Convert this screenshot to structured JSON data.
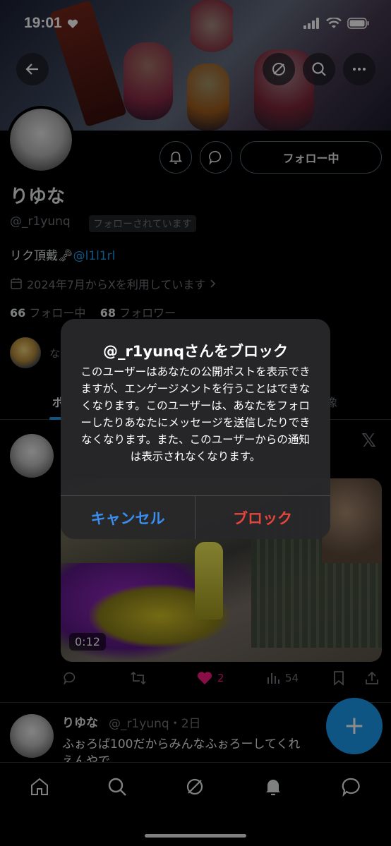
{
  "status_bar": {
    "time": "19:01"
  },
  "profile": {
    "follow_button": "フォロー中",
    "name": "りゆな",
    "handle": "@_r1yunq",
    "follows_you": "フォローされています",
    "bio_text": "リク頂戴",
    "bio_mention": "@l1l1rl",
    "joined": "2024年7月からXを利用しています",
    "following_count": "66",
    "following_label": "フォロー中",
    "followers_count": "68",
    "followers_label": "フォロワー",
    "followed_by_text": "な"
  },
  "tabs": {
    "left_label": "ポ",
    "right_label": "像"
  },
  "tweet1": {
    "x_logo": "𝕏",
    "video_duration": "0:12",
    "likes": "2",
    "views": "54"
  },
  "tweet2": {
    "name": "りゆな",
    "meta": "@_r1yunq・2日",
    "text": "ふぉろば100だからみんなふぉろーしてくれ",
    "text2": "えんやで"
  },
  "fab": {
    "label": "+"
  },
  "dialog": {
    "title": "@_r1yunqさんをブロック",
    "message": "このユーザーはあなたの公開ポストを表示できますが、エンゲージメントを行うことはできなくなります。このユーザーは、あなたをフォローしたりあなたにメッセージを送信したりできなくなります。また、このユーザーからの通知は表示されなくなります。",
    "cancel_label": "キャンセル",
    "block_label": "ブロック"
  },
  "colors": {
    "accent": "#1d9bf0",
    "destructive": "#e6453c",
    "like": "#f91880"
  }
}
